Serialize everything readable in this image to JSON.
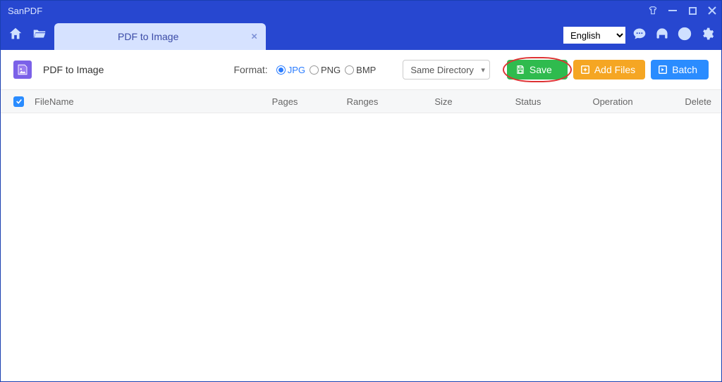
{
  "window": {
    "title": "SanPDF"
  },
  "topbar": {
    "language": "English"
  },
  "tab": {
    "label": "PDF to Image"
  },
  "toolbar": {
    "section_title": "PDF to Image",
    "format_label": "Format:",
    "formats": {
      "jpg": "JPG",
      "png": "PNG",
      "bmp": "BMP"
    },
    "directory": "Same Directory",
    "save_label": "Save",
    "add_files_label": "Add Files",
    "batch_label": "Batch"
  },
  "columns": {
    "filename": "FileName",
    "pages": "Pages",
    "ranges": "Ranges",
    "size": "Size",
    "status": "Status",
    "operation": "Operation",
    "delete": "Delete"
  }
}
